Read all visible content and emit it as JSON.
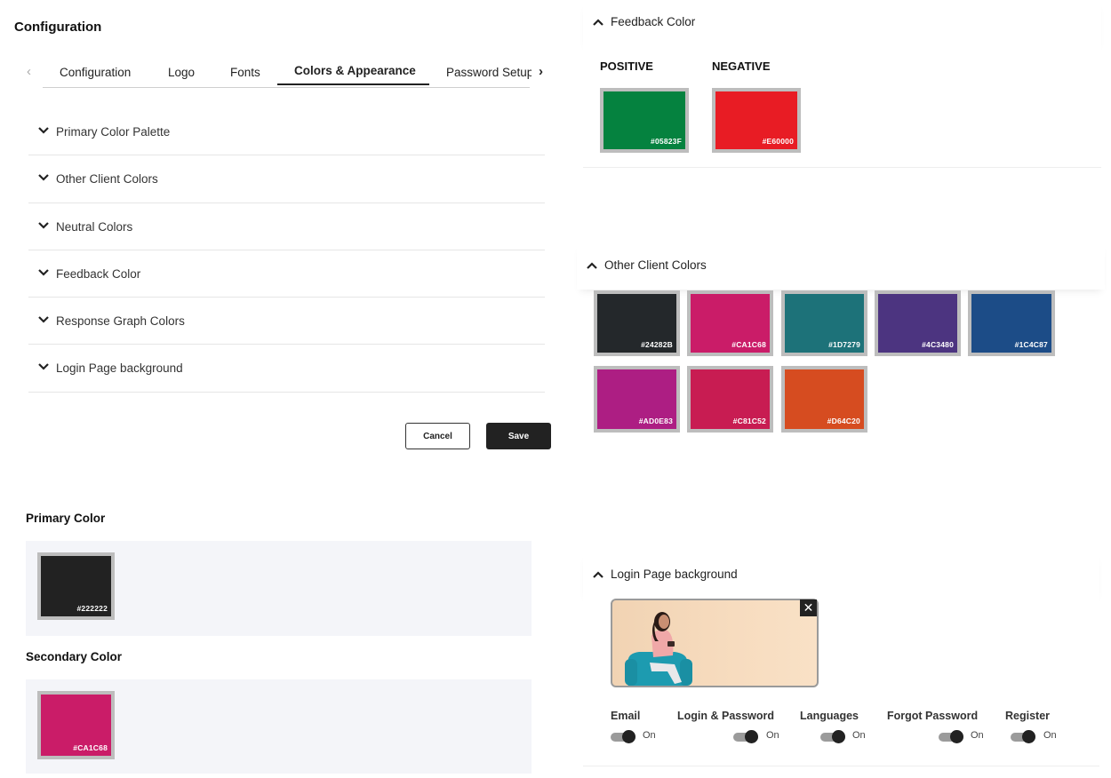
{
  "page": {
    "title": "Configuration"
  },
  "tabs": {
    "items": [
      {
        "label": "Configuration"
      },
      {
        "label": "Logo"
      },
      {
        "label": "Fonts"
      },
      {
        "label": "Colors & Appearance",
        "active": true
      },
      {
        "label": "Password Setup"
      }
    ],
    "prev_icon": "chevron-left-icon",
    "next_icon": "chevron-right-icon"
  },
  "accordion": {
    "items": [
      {
        "label": "Primary Color Palette"
      },
      {
        "label": "Other Client Colors"
      },
      {
        "label": "Neutral Colors"
      },
      {
        "label": "Feedback Color"
      },
      {
        "label": "Response Graph Colors"
      },
      {
        "label": "Login Page background"
      }
    ],
    "icon": "chevron-down-icon"
  },
  "actions": {
    "cancel_label": "Cancel",
    "save_label": "Save"
  },
  "primary": {
    "title": "Primary Color",
    "hex": "#222222",
    "color": "#222222"
  },
  "secondary": {
    "title": "Secondary Color",
    "hex": "#CA1C68",
    "color": "#CA1C68"
  },
  "feedback": {
    "title": "Feedback Color",
    "icon": "chevron-up-icon",
    "positive": {
      "label": "POSITIVE",
      "hex": "#05823F",
      "color": "#05823F"
    },
    "negative": {
      "label": "NEGATIVE",
      "hex": "#E60000",
      "color": "#E81C24"
    }
  },
  "other_client": {
    "title": "Other Client Colors",
    "icon": "chevron-up-icon",
    "swatches": [
      {
        "hex": "#24282B",
        "color": "#24282B"
      },
      {
        "hex": "#CA1C68",
        "color": "#CA1C68"
      },
      {
        "hex": "#1D7279",
        "color": "#1D7279"
      },
      {
        "hex": "#4C3480",
        "color": "#4C3480"
      },
      {
        "hex": "#1C4C87",
        "color": "#1C4C87"
      },
      {
        "hex": "#AD0E83",
        "color": "#AD1E83"
      },
      {
        "hex": "#C81C52",
        "color": "#C81C52"
      },
      {
        "hex": "#D64C20",
        "color": "#D64C20"
      }
    ]
  },
  "login_bg": {
    "title": "Login Page background",
    "icon": "chevron-up-icon",
    "close_label": "✕",
    "toggles": [
      {
        "label": "Email",
        "state": "On"
      },
      {
        "label": "Login & Password",
        "state": "On"
      },
      {
        "label": "Languages",
        "state": "On"
      },
      {
        "label": "Forgot Password",
        "state": "On"
      },
      {
        "label": "Register",
        "state": "On"
      }
    ]
  }
}
